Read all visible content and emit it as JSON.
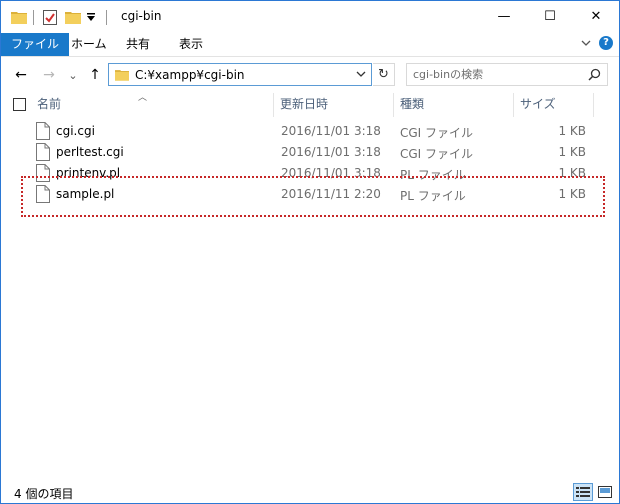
{
  "window": {
    "title": "cgi-bin",
    "controls": {
      "minimize": "—",
      "maximize": "☐",
      "close": "✕"
    }
  },
  "ribbon": {
    "tabs": [
      {
        "label": "ファイル",
        "active": true
      },
      {
        "label": "ホーム",
        "active": false
      },
      {
        "label": "共有",
        "active": false
      },
      {
        "label": "表示",
        "active": false
      }
    ]
  },
  "nav": {
    "back": "←",
    "forward": "→",
    "recent": "⌄",
    "up": "↑",
    "address": "C:¥xampp¥cgi-bin",
    "refresh": "↻",
    "search_placeholder": "cgi-binの検索"
  },
  "columns": {
    "name": "名前",
    "date": "更新日時",
    "type": "種類",
    "size": "サイズ"
  },
  "files": [
    {
      "name": "cgi.cgi",
      "date": "2016/11/01 3:18",
      "type": "CGI ファイル",
      "size": "1 KB"
    },
    {
      "name": "perltest.cgi",
      "date": "2016/11/01 3:18",
      "type": "CGI ファイル",
      "size": "1 KB"
    },
    {
      "name": "printenv.pl",
      "date": "2016/11/01 3:18",
      "type": "PL ファイル",
      "size": "1 KB"
    },
    {
      "name": "sample.pl",
      "date": "2016/11/11 2:20",
      "type": "PL ファイル",
      "size": "1 KB"
    }
  ],
  "status": {
    "item_count": "4 個の項目"
  },
  "colors": {
    "accent": "#1979ca",
    "highlight": "#c62828",
    "folder": "#f0c043"
  }
}
